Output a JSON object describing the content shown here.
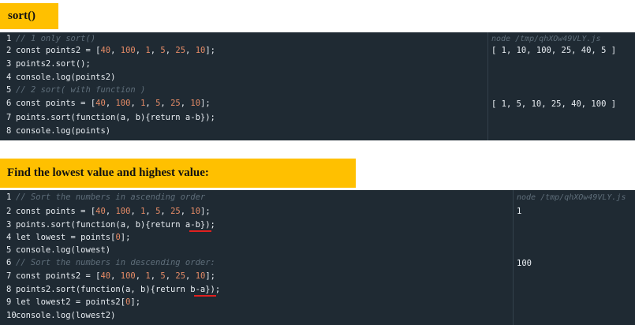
{
  "banner1": {
    "title": "sort()"
  },
  "panel1": {
    "lines": [
      {
        "n": "1",
        "text": "// 1 only sort()",
        "type": "comment"
      },
      {
        "n": "2",
        "text": "const points2 = [40, 100, 1, 5, 25, 10];",
        "type": "code"
      },
      {
        "n": "3",
        "text": "points2.sort();",
        "type": "code"
      },
      {
        "n": "4",
        "text": "console.log(points2)",
        "type": "code"
      },
      {
        "n": "5",
        "text": "// 2 sort( with function )",
        "type": "comment"
      },
      {
        "n": "6",
        "text": "const points = [40, 100, 1, 5, 25, 10];",
        "type": "code"
      },
      {
        "n": "7",
        "text": "points.sort(function(a, b){return a-b});",
        "type": "code"
      },
      {
        "n": "8",
        "text": "console.log(points)",
        "type": "code"
      }
    ],
    "output_header": "node /tmp/qhXOw49VLY.js",
    "output1": "[ 1, 10, 100, 25, 40, 5 ]",
    "output2_a": "[",
    "output2_b": " 1, 5, 10, 25, 40, 100 ",
    "output2_c": "]"
  },
  "banner2": {
    "title": "Find the lowest value  and  highest value:"
  },
  "panel2": {
    "lines": [
      {
        "n": "1",
        "text": "// Sort the numbers in ascending order",
        "type": "comment"
      },
      {
        "n": "2",
        "text": "const points = [40, 100, 1, 5, 25, 10];",
        "type": "code"
      },
      {
        "n": "3",
        "text": "points.sort(function(a, b){return a-b});",
        "type": "code"
      },
      {
        "n": "4",
        "text": "let lowest = points[0];",
        "type": "code"
      },
      {
        "n": "5",
        "text": "console.log(lowest)",
        "type": "code"
      },
      {
        "n": "6",
        "text": "// Sort the numbers in descending order:",
        "type": "comment"
      },
      {
        "n": "7",
        "text": "const points2 = [40, 100, 1, 5, 25, 10];",
        "type": "code"
      },
      {
        "n": "8",
        "text": "points2.sort(function(a, b){return b-a});",
        "type": "code"
      },
      {
        "n": "9",
        "text": "let lowest2 = points2[0];",
        "type": "code"
      },
      {
        "n": "10",
        "text": "console.log(lowest2)",
        "type": "code"
      }
    ],
    "output_header": "node /tmp/qhXOw49VLY.js",
    "output1": "1",
    "output2": "100"
  },
  "colors": {
    "banner": "#ffc000",
    "panel": "#1f2a33",
    "comment": "#5f6e7a",
    "number": "#e58b66",
    "underline": "#e0201f"
  }
}
